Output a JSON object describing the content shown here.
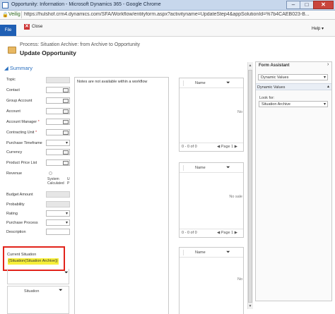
{
  "window": {
    "title": "Opportunity: Information - Microsoft Dynamics 365 - Google Chrome",
    "minimize": "–",
    "maximize": "□",
    "close": "✕"
  },
  "address": {
    "secure_label": "Veilig",
    "url": "https://hulshof.crm4.dynamics.com/SFA/Workflow/entityform.aspx?activityname=UpdateStep4&appSolutionId=%7b4CAEB023-B..."
  },
  "commandbar": {
    "file_label": "File",
    "close_label": "Close",
    "help_label": "Help ▾"
  },
  "header": {
    "process_line": "Process: Situation Archive: from Archive to Opportunity",
    "title": "Update Opportunity"
  },
  "summary": {
    "section_label": "◢ Summary",
    "fields": [
      {
        "label": "Topic"
      },
      {
        "label": "Contact"
      },
      {
        "label": "Group Account"
      },
      {
        "label": "Account"
      },
      {
        "label": "Account Manager"
      },
      {
        "label": "Contracting Unit"
      },
      {
        "label": "Purchase Timeframe"
      },
      {
        "label": "Currency"
      },
      {
        "label": "Product Price List"
      },
      {
        "label": "Revenue"
      },
      {
        "label": "Budget Amount"
      },
      {
        "label": "Probability"
      },
      {
        "label": "Rating"
      },
      {
        "label": "Purchase Process"
      },
      {
        "label": "Description"
      }
    ],
    "revenue_options": [
      "System Calculated",
      "U P"
    ],
    "required_marker": "*"
  },
  "notes": {
    "text": "Notes are not available within a workflow"
  },
  "grids": [
    {
      "column": "Name",
      "message": "No",
      "pager": "0 - 0 of 0",
      "page": "◀ Page 1 ▶"
    },
    {
      "column": "Name",
      "message": "No sale",
      "pager": "0 - 0 of 0",
      "page": "◀ Page 1 ▶"
    },
    {
      "column": "Name",
      "message": "No"
    }
  ],
  "current_situation": {
    "label": "Current Situation",
    "value": "{Situation(Situation Archive)}",
    "grid_column": "Situation"
  },
  "assistant": {
    "title": "Form Assistant",
    "select1": "Dynamic Values",
    "section": "Dynamic Values",
    "look_for_label": "Look for:",
    "select2": "Situation Archive"
  },
  "colors": {
    "file_tab": "#1f5fb4",
    "highlight_border": "#e2231a",
    "highlight_fill": "#f7ef3a"
  }
}
